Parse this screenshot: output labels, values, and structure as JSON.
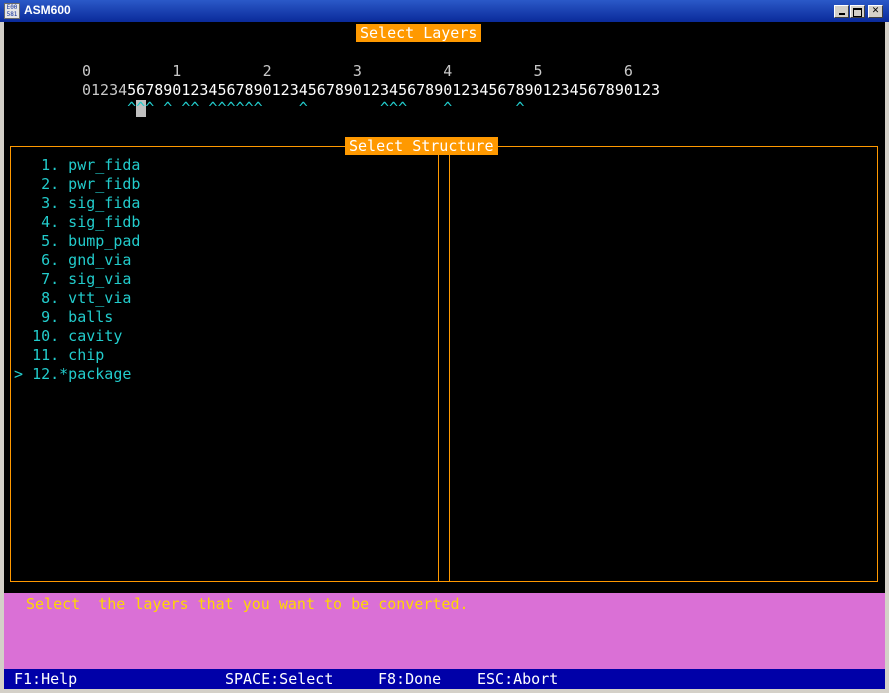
{
  "window": {
    "title": "ASM600",
    "icon_text": "E00\n581",
    "icon": "app-icon",
    "controls": {
      "minimize": "minimize-icon",
      "maximize": "maximize-icon",
      "close": "close-icon"
    }
  },
  "layers": {
    "title": "Select Layers",
    "tens_row": "0         1         2         3         4         5         6",
    "units_row": "0123456789012345678901234567890123456789012345678901234567890123",
    "selection_marks": "     ^^^ ^ ^^ ^^^^^^    ^        ^^^    ^       ^",
    "cursor_index": 5
  },
  "structure": {
    "title": "Select Structure",
    "items": [
      {
        "marker": " ",
        "number": " 1.",
        "name": " pwr_fida"
      },
      {
        "marker": " ",
        "number": " 2.",
        "name": " pwr_fidb"
      },
      {
        "marker": " ",
        "number": " 3.",
        "name": " sig_fida"
      },
      {
        "marker": " ",
        "number": " 4.",
        "name": " sig_fidb"
      },
      {
        "marker": " ",
        "number": " 5.",
        "name": " bump_pad"
      },
      {
        "marker": " ",
        "number": " 6.",
        "name": " gnd_via"
      },
      {
        "marker": " ",
        "number": " 7.",
        "name": " sig_via"
      },
      {
        "marker": " ",
        "number": " 8.",
        "name": " vtt_via"
      },
      {
        "marker": " ",
        "number": " 9.",
        "name": " balls"
      },
      {
        "marker": " ",
        "number": "10.",
        "name": " cavity"
      },
      {
        "marker": " ",
        "number": "11.",
        "name": " chip"
      },
      {
        "marker": ">",
        "number": "12.",
        "name": "*package"
      }
    ],
    "selected_index": 11
  },
  "message": "Select  the layers that you want to be converted.",
  "status_bar": {
    "help": "F1:Help",
    "select": "SPACE:Select",
    "done": "F8:Done",
    "abort": "ESC:Abort"
  },
  "colors": {
    "accent_orange": "#ff9900",
    "text_cyan": "#22cccc",
    "message_bg": "#da70d6",
    "message_text": "#ffd700",
    "status_bg": "#0000a8",
    "titlebar": "#0a2a9a"
  }
}
